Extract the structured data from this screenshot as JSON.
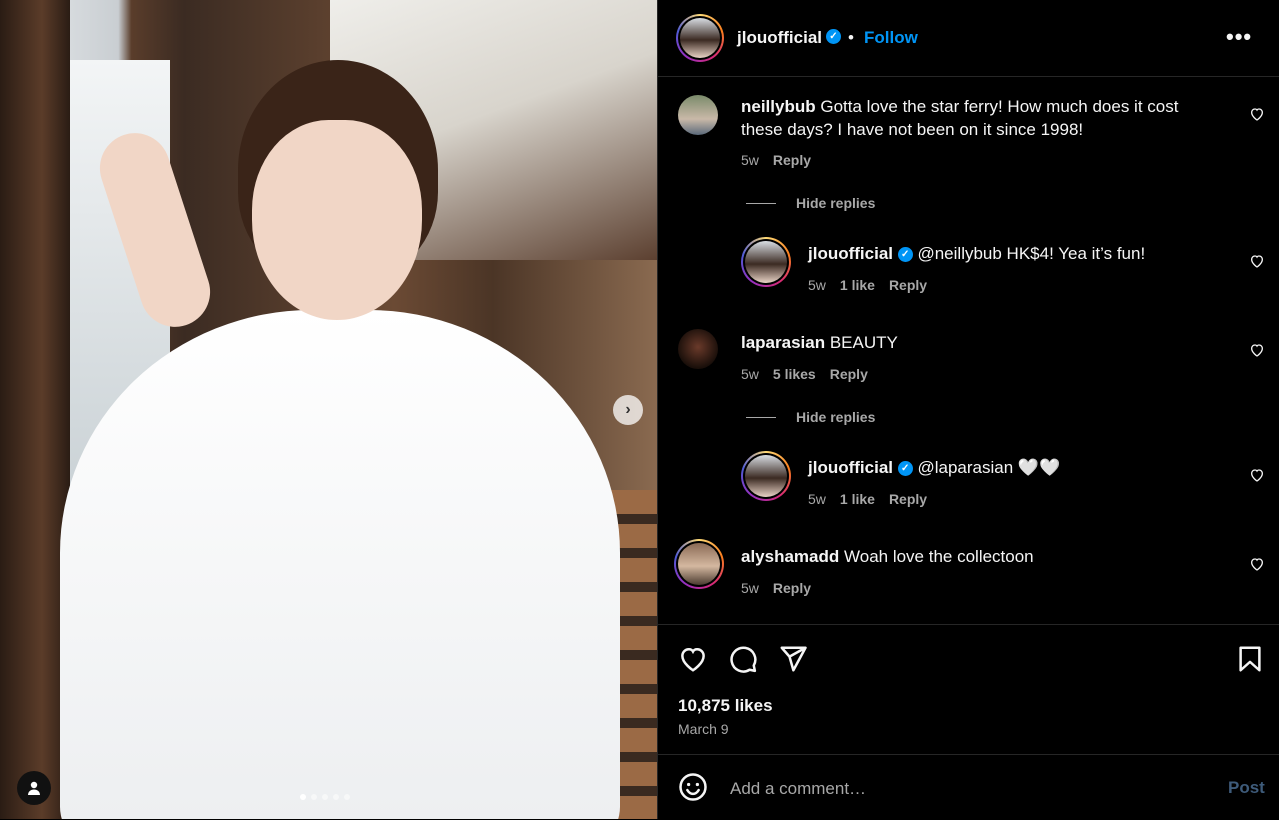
{
  "post": {
    "author": "jlouofficial",
    "follow_label": "Follow",
    "separator": "•",
    "more_label": "•••",
    "carousel": {
      "slides": 5,
      "active_index": 0,
      "next_label": "›"
    },
    "likes": "10,875 likes",
    "date": "March 9"
  },
  "comments": [
    {
      "user": "neillybub",
      "text": "Gotta love the star ferry! How much does it cost these days? I have not been on it since 1998!",
      "age": "5w",
      "reply_label": "Reply",
      "hide_replies_label": "Hide replies",
      "replies": [
        {
          "user": "jlouofficial",
          "text": "@neillybub HK$4! Yea it’s fun!",
          "age": "5w",
          "likes": "1 like",
          "reply_label": "Reply"
        }
      ]
    },
    {
      "user": "laparasian",
      "text": "BEAUTY",
      "age": "5w",
      "likes": "5 likes",
      "reply_label": "Reply",
      "hide_replies_label": "Hide replies",
      "replies": [
        {
          "user": "jlouofficial",
          "text": "@laparasian 🤍🤍",
          "age": "5w",
          "likes": "1 like",
          "reply_label": "Reply"
        }
      ]
    },
    {
      "user": "alyshamadd",
      "text": "Woah love the collectoon",
      "age": "5w",
      "reply_label": "Reply"
    }
  ],
  "composer": {
    "placeholder": "Add a comment…",
    "post_label": "Post"
  },
  "colors": {
    "link_blue": "#0095f6",
    "muted": "#a8a8a8",
    "post_disabled": "#3e5b7a"
  }
}
